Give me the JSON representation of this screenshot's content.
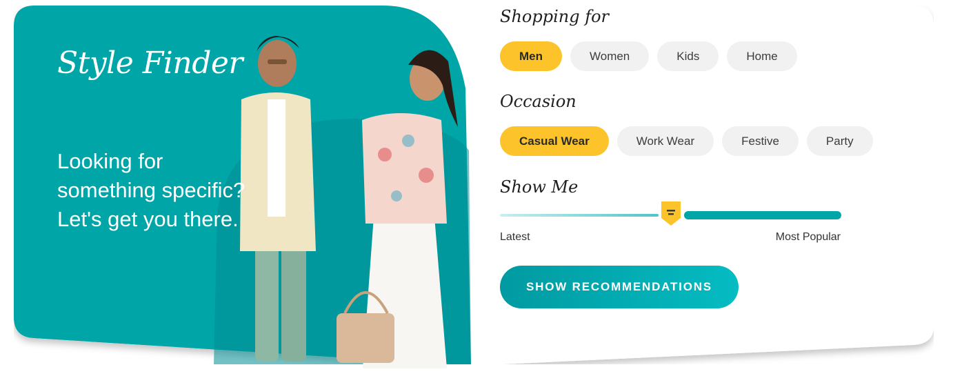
{
  "hero": {
    "title": "Style Finder",
    "tagline": "Looking for something specific? Let's get you there."
  },
  "shopping_for": {
    "label": "Shopping for",
    "options": [
      "Men",
      "Women",
      "Kids",
      "Home"
    ],
    "selected": "Men"
  },
  "occasion": {
    "label": "Occasion",
    "options": [
      "Casual Wear",
      "Work Wear",
      "Festive",
      "Party"
    ],
    "selected": "Casual Wear"
  },
  "show_me": {
    "label": "Show Me",
    "min_label": "Latest",
    "max_label": "Most Popular",
    "value_fraction": 0.5
  },
  "cta": {
    "label": "SHOW RECOMMENDATIONS"
  },
  "colors": {
    "teal": "#00a5a8",
    "accent_yellow": "#fcc42a",
    "chip_bg": "#f1f1f1"
  }
}
